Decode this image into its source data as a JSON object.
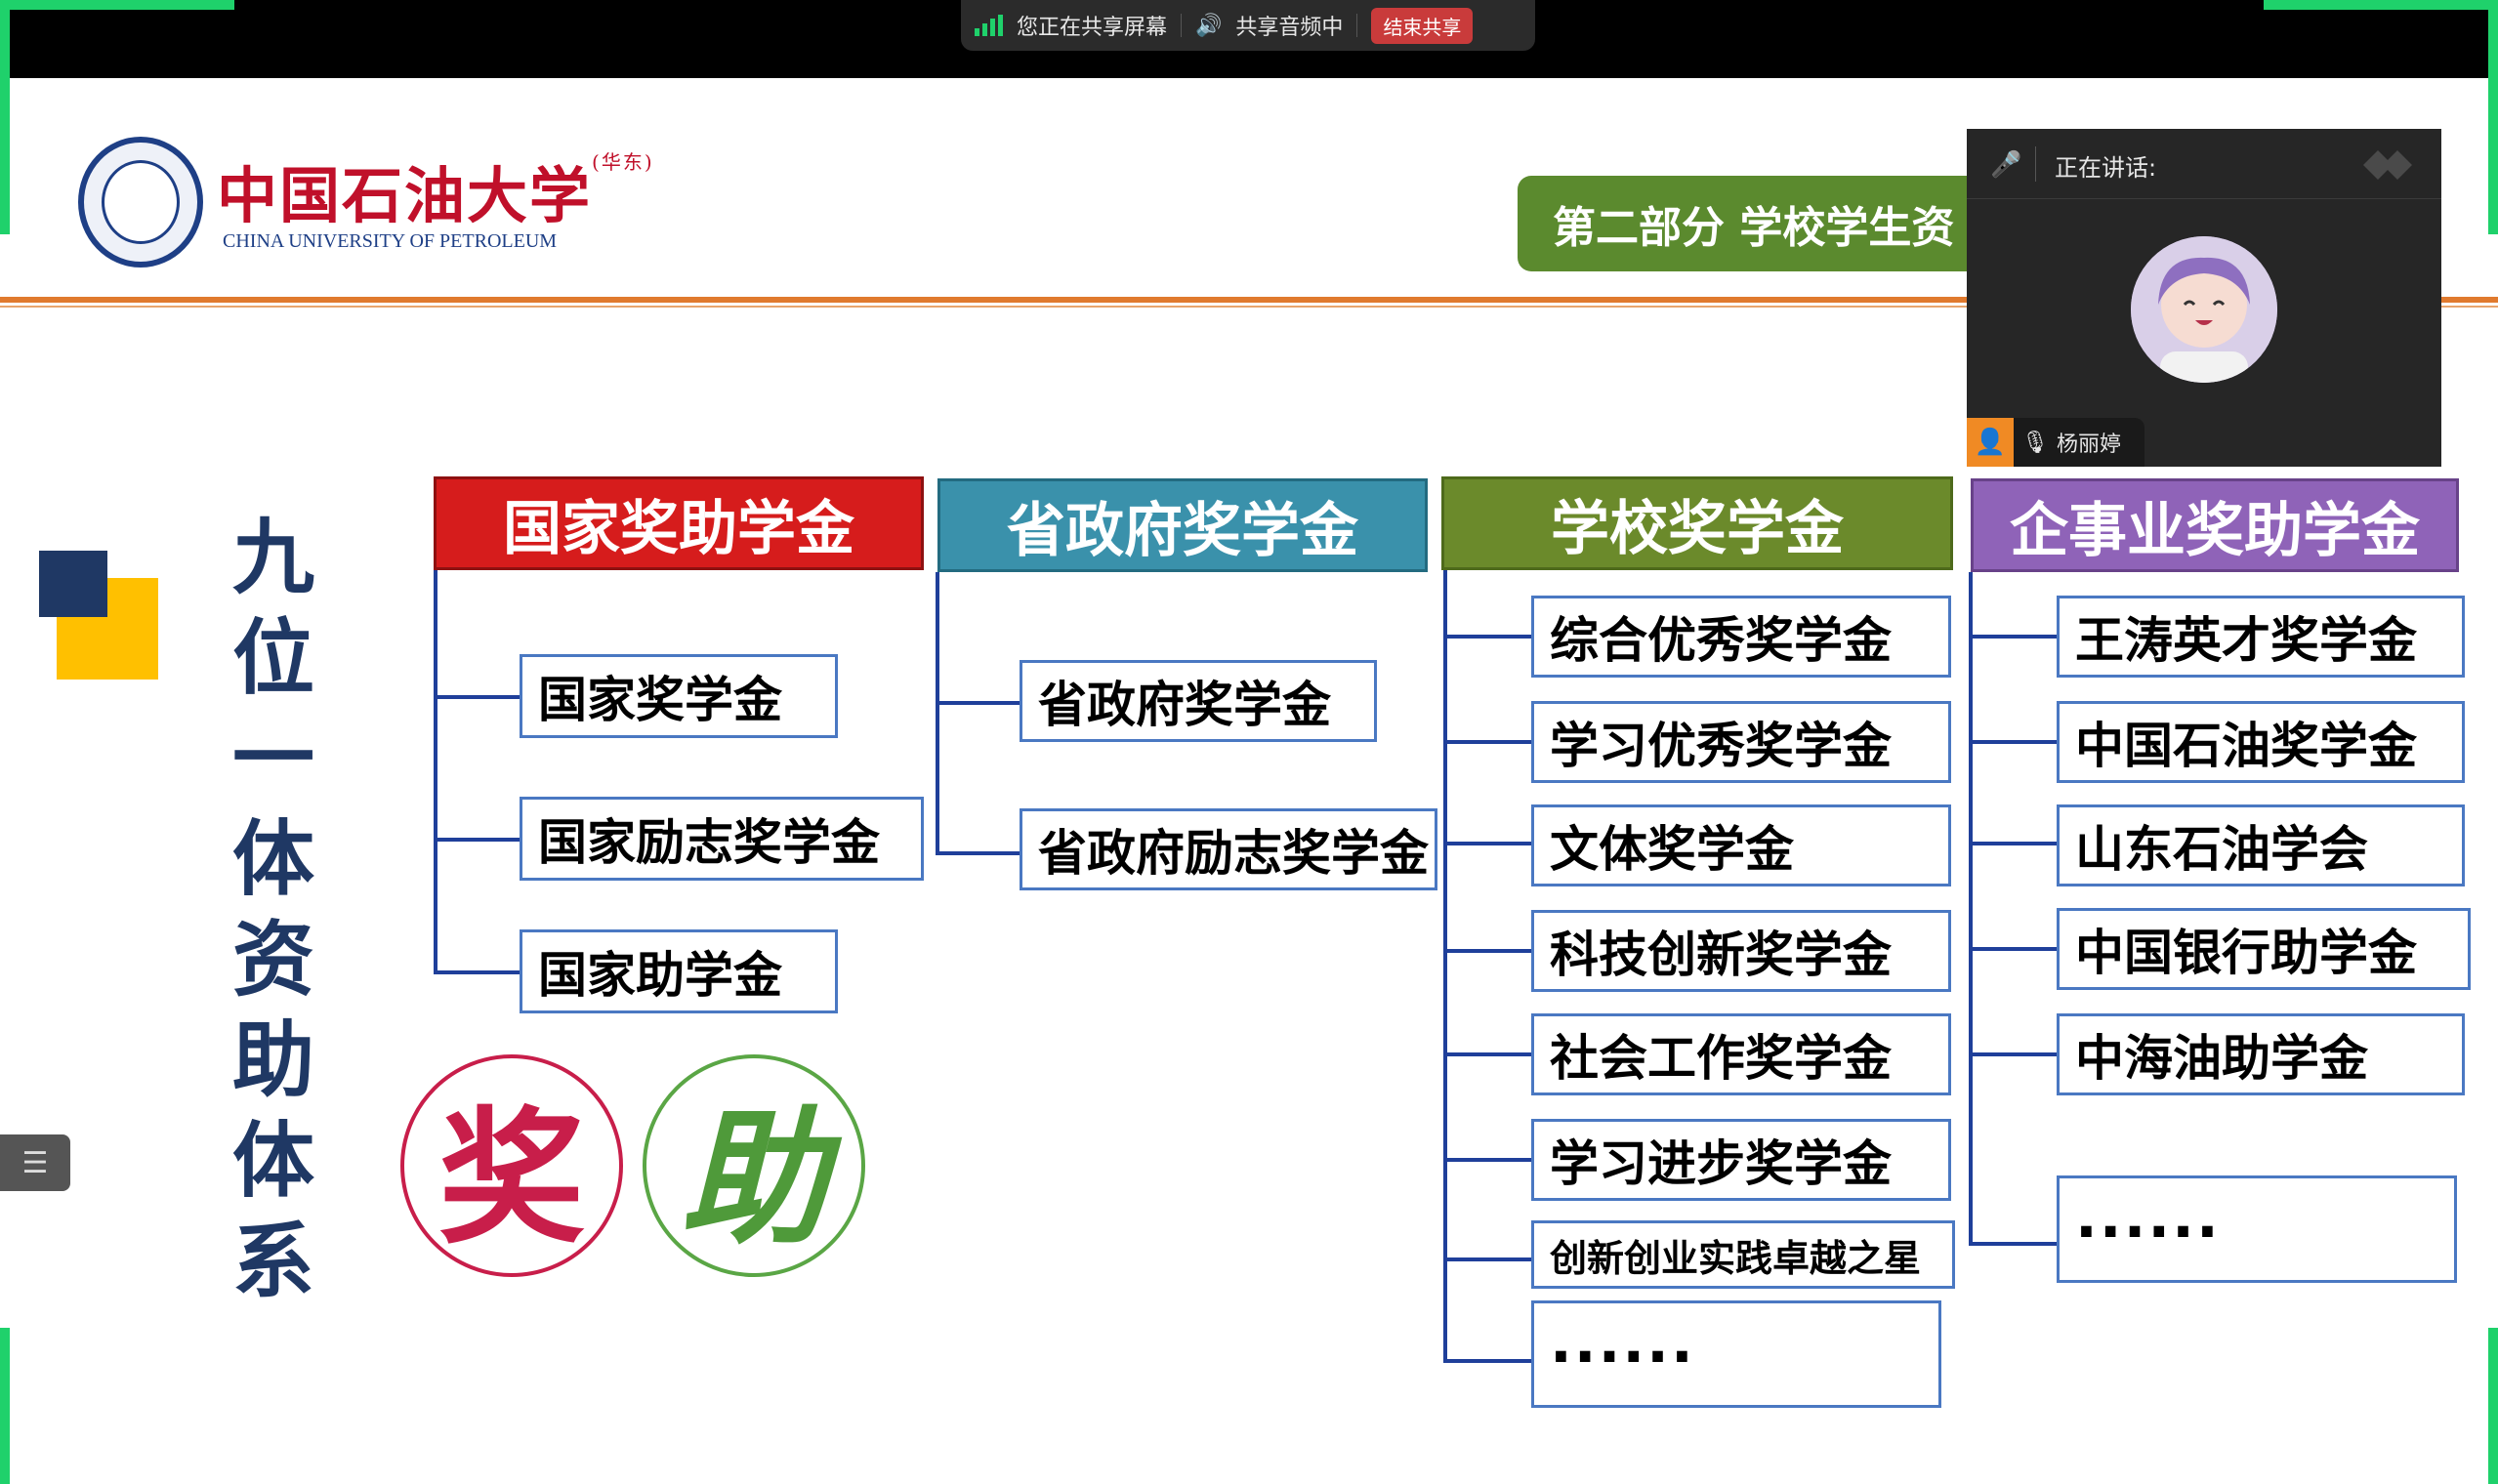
{
  "share_bar": {
    "sharing_text": "您正在共享屏幕",
    "audio_text": "共享音频中",
    "end_button": "结束共享"
  },
  "slide": {
    "logo": {
      "cn_name": "中国石油大学",
      "cn_suffix": "(华东)",
      "en_name": "CHINA UNIVERSITY OF PETROLEUM"
    },
    "section_tab": "第二部分  学校学生资",
    "vertical_title": [
      "九",
      "位",
      "一",
      "体",
      "资",
      "助",
      "体",
      "系"
    ],
    "circles": {
      "jiang": "奖",
      "zhu": "助"
    },
    "categories": [
      {
        "title": "国家奖助学金",
        "items": [
          "国家奖学金",
          "国家励志奖学金",
          "国家助学金"
        ]
      },
      {
        "title": "省政府奖学金",
        "items": [
          "省政府奖学金",
          "省政府励志奖学金"
        ]
      },
      {
        "title": "学校奖学金",
        "items": [
          "综合优秀奖学金",
          "学习优秀奖学金",
          "文体奖学金",
          "科技创新奖学金",
          "社会工作奖学金",
          "学习进步奖学金",
          "创新创业实践卓越之星",
          "······"
        ]
      },
      {
        "title": "企事业奖助学金",
        "items": [
          "王涛英才奖学金",
          "中国石油奖学金",
          "山东石油学会",
          "中国银行助学金",
          "中海油助学金",
          "······"
        ]
      }
    ]
  },
  "speaker_panel": {
    "label": "正在讲话:",
    "name": "杨丽婷"
  },
  "colors": {
    "national": "#d61c1c",
    "provincial": "#3a91ab",
    "school": "#6b8a2b",
    "enterprise": "#8f63b8",
    "connector": "#1f3f9a",
    "item_border": "#4a78c2"
  }
}
